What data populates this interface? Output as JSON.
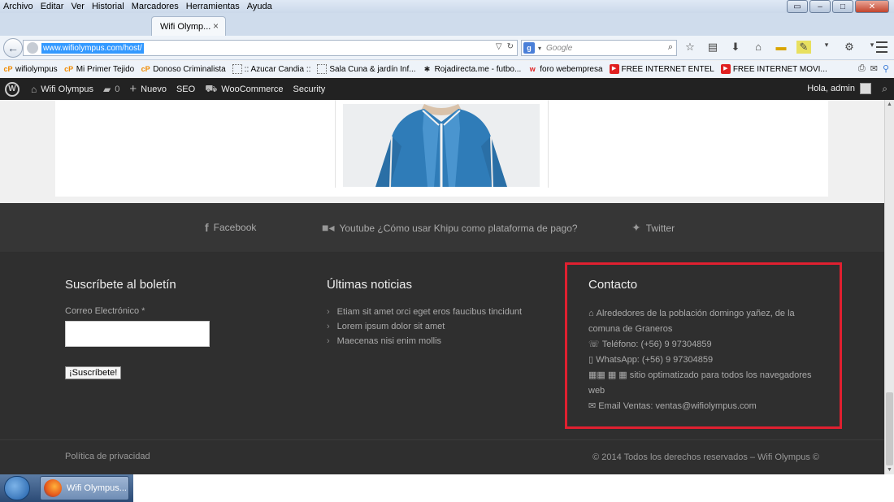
{
  "menu": [
    "Archivo",
    "Editar",
    "Ver",
    "Historial",
    "Marcadores",
    "Herramientas",
    "Ayuda"
  ],
  "tab": {
    "title": "Wifi Olymp...",
    "close": "×"
  },
  "nav": {
    "url": "www.wifiolympus.com/host/",
    "search_placeholder": "Google"
  },
  "bookmarks": [
    {
      "icon": "cp-icon",
      "label": "wifiolympus"
    },
    {
      "icon": "cp-icon",
      "label": "Mi Primer Tejido"
    },
    {
      "icon": "cp-icon",
      "label": "Donoso Criminalista"
    },
    {
      "icon": "dotted-page-icon",
      "label": ":: Azucar Candia ::"
    },
    {
      "icon": "dotted-page-icon",
      "label": "Sala Cuna & jardín Inf..."
    },
    {
      "icon": "rojadirecta-icon",
      "label": "Rojadirecta.me - futbo..."
    },
    {
      "icon": "webempresa-icon",
      "label": "foro webempresa"
    },
    {
      "icon": "youtube-icon",
      "label": "FREE INTERNET ENTEL"
    },
    {
      "icon": "youtube-icon",
      "label": "FREE INTERNET MOVI..."
    }
  ],
  "wpbar": {
    "site": "Wifi Olympus",
    "comments": "0",
    "new": "Nuevo",
    "seo": "SEO",
    "woo": "WooCommerce",
    "security": "Security",
    "greeting": "Hola, admin"
  },
  "social": {
    "facebook": "Facebook",
    "youtube": "Youtube ¿Cómo usar Khipu como plataforma de pago?",
    "twitter": "Twitter"
  },
  "newsletter": {
    "title": "Suscríbete al boletín",
    "email_label": "Correo Electrónico *",
    "button": "¡Suscríbete!"
  },
  "news": {
    "title": "Últimas noticias",
    "items": [
      "Etiam sit amet orci eget eros faucibus tincidunt",
      "Lorem ipsum dolor sit amet",
      "Maecenas nisi enim mollis"
    ]
  },
  "contact": {
    "title": "Contacto",
    "address": "Alrededores de la población domingo yañez, de la comuna de Graneros",
    "phone": "Teléfono: (+56) 9 97304859",
    "whatsapp": "WhatsApp: (+56) 9 97304859",
    "browsers": "sitio optimatizado para todos los navegadores web",
    "email": "Email Ventas: ventas@wifiolympus.com"
  },
  "bottom": {
    "privacy": "Política de privacidad",
    "copyright": "© 2014 Todos los derechos reservados – Wifi Olympus ©"
  },
  "taskbar": {
    "window": "Wifi Olympus..."
  },
  "colors": {
    "highlight": "#e02030",
    "footer": "#2f2f2f",
    "social": "#363636",
    "wpbar": "#222222"
  }
}
